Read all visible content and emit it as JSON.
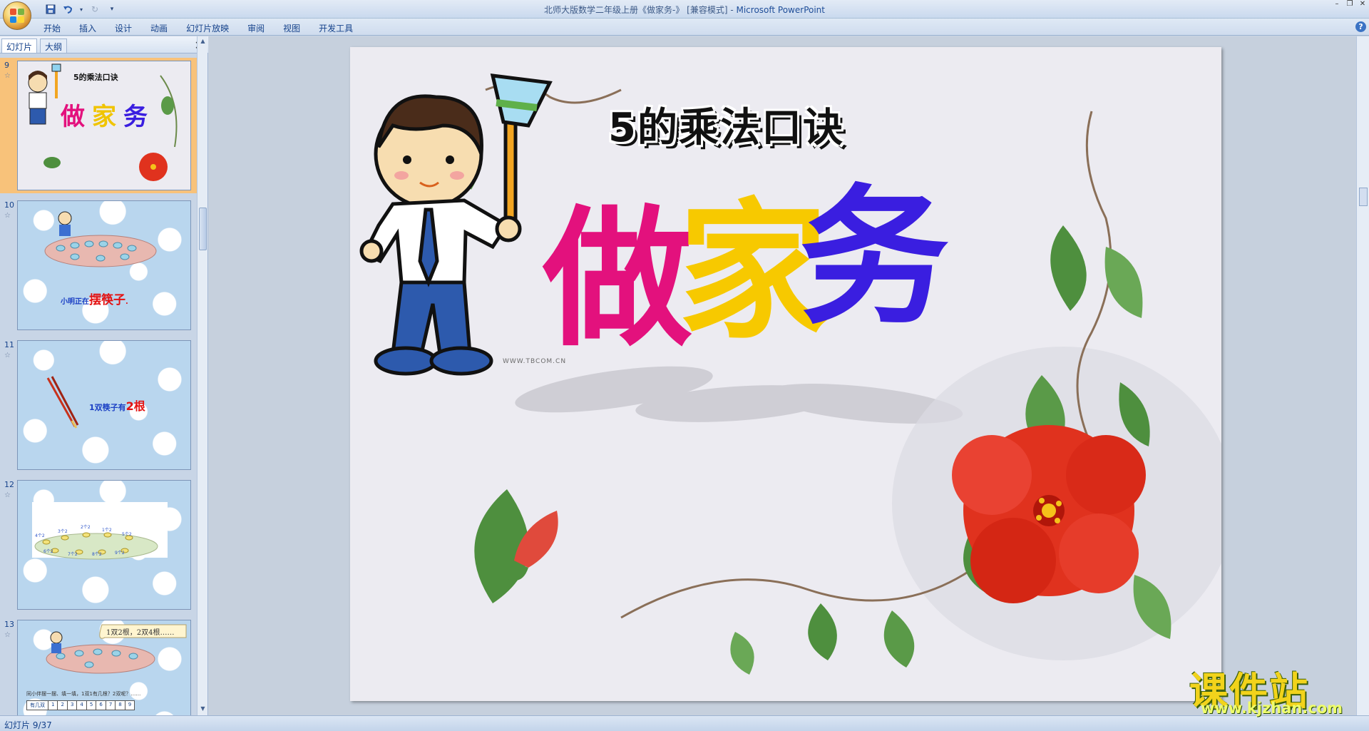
{
  "window": {
    "title_doc": "北师大版数学二年级上册《做家务-》 [兼容模式] - ",
    "title_app": "Microsoft PowerPoint"
  },
  "ribbon": {
    "tabs": [
      "开始",
      "插入",
      "设计",
      "动画",
      "幻灯片放映",
      "审阅",
      "视图",
      "开发工具"
    ]
  },
  "left_pane": {
    "tabs": [
      "幻灯片",
      "大纲"
    ],
    "slides": [
      {
        "num": "9",
        "selected": true,
        "title": "5的乘法口诀",
        "big": "做家务"
      },
      {
        "num": "10",
        "selected": false,
        "caption_a": "小明正在",
        "caption_b": "摆筷子",
        "caption_c": "."
      },
      {
        "num": "11",
        "selected": false,
        "caption_a": "1双筷子有",
        "caption_b": "2根"
      },
      {
        "num": "12",
        "selected": false,
        "labels": [
          "4个2",
          "3个2",
          "2个2",
          "1个2",
          "5个2",
          "6个2",
          "7个2",
          "8个2",
          "9个2"
        ]
      },
      {
        "num": "13",
        "selected": false,
        "bubble": "1双2根，2双4根……",
        "question": "同小伴摆一摆、填一填，1双1有几根？2双呢？……",
        "table_head": "有几双",
        "table_nums": [
          "1",
          "2",
          "3",
          "4",
          "5",
          "6",
          "7",
          "8",
          "9"
        ]
      }
    ]
  },
  "slide": {
    "title": "5的乘法口诀",
    "heading_chars": [
      "做",
      "家",
      "务"
    ],
    "heading_colors": [
      "#e3117d",
      "#f7c900",
      "#3a1ee0"
    ],
    "small_watermark": "WWW.TBCOM.CN"
  },
  "status": {
    "text": "幻灯片 9/37"
  },
  "watermark": {
    "cn": "课件站",
    "url": "www.kjzhan.com"
  }
}
